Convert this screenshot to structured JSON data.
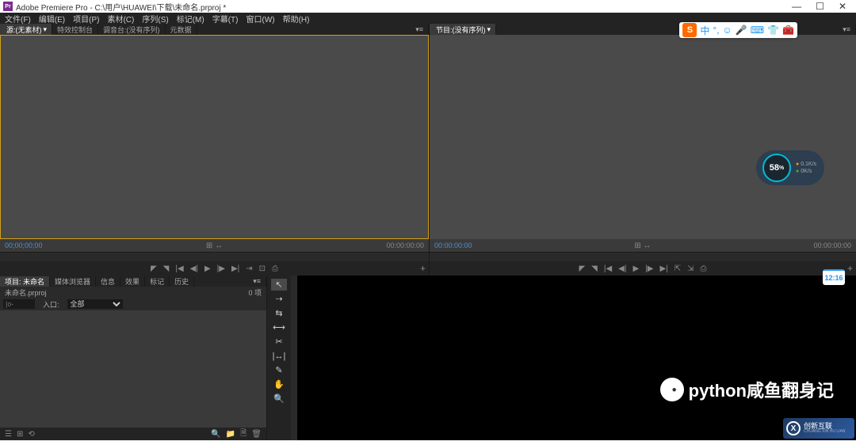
{
  "window": {
    "app_icon": "Pr",
    "title": "Adobe Premiere Pro - C:\\用户\\HUAWEI\\下载\\未命名.prproj *",
    "controls": {
      "min": "—",
      "max": "☐",
      "close": "✕"
    }
  },
  "menu": {
    "file": "文件(F)",
    "edit": "编辑(E)",
    "project": "项目(P)",
    "clip": "素材(C)",
    "sequence": "序列(S)",
    "marker": "标记(M)",
    "title": "字幕(T)",
    "window": "窗口(W)",
    "help": "帮助(H)"
  },
  "source_panel": {
    "tabs": {
      "source": "源:(无素材)",
      "effect_controls": "特效控制台",
      "audio_mixer": "调音台:(没有序列)",
      "metadata": "元数据"
    },
    "tc_left": "00;00;00;00",
    "tc_right": "00:00:00:00"
  },
  "program_panel": {
    "tab": "节目:(没有序列)",
    "tc_left": "00:00:00:00",
    "tc_right": "00:00:00:00"
  },
  "project_panel": {
    "tabs": {
      "project": "项目: 未命名",
      "media_browser": "媒体浏览器",
      "info": "信息",
      "effects": "效果",
      "markers": "标记",
      "history": "历史"
    },
    "filename": "未命名.prproj",
    "items_count": "0 项",
    "filter_label": "入口:",
    "filter_value": "全部",
    "search_placeholder": "|o-"
  },
  "ime": {
    "logo": "S",
    "lang": "中"
  },
  "speed_widget": {
    "percent": "58",
    "unit": "%",
    "up": "0.1K/s",
    "down": "0K/s"
  },
  "time_badge": "12:16",
  "watermark": "python咸鱼翻身记",
  "logo_badge": {
    "mark": "X",
    "name": "创新互联",
    "sub": "CHUANG XIN HU LIAN"
  }
}
